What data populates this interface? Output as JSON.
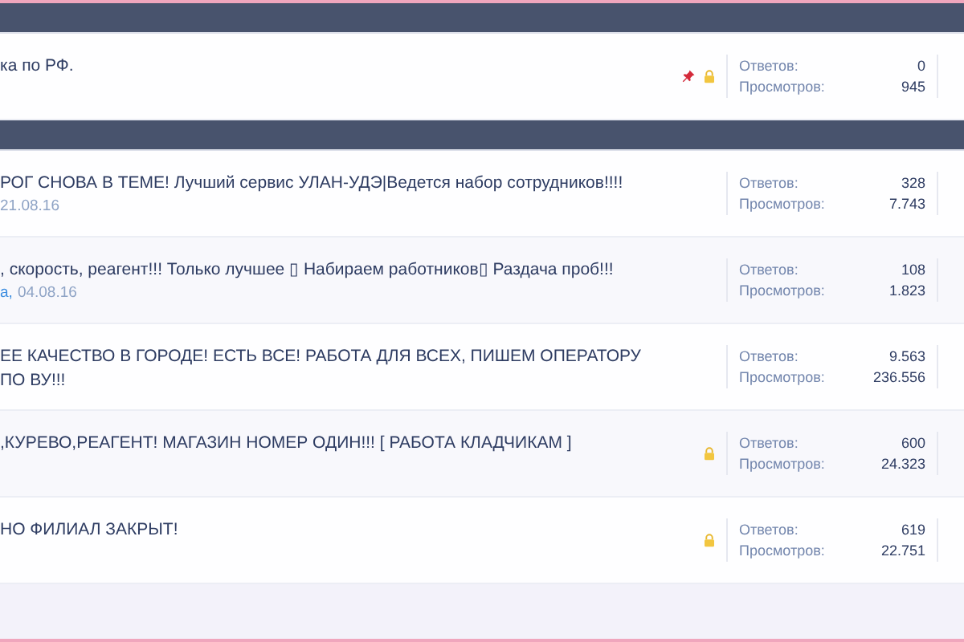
{
  "sections": [
    {
      "threads": [
        {
          "title": "ка по РФ.",
          "pinned": true,
          "locked": true,
          "replies_label": "Ответов:",
          "replies": "0",
          "views_label": "Просмотров:",
          "views": "945"
        }
      ]
    },
    {
      "threads": [
        {
          "title": "РОГ СНОВА В ТЕМЕ! Лучший сервис УЛАН-УДЭ|Ведется набор сотрудников!!!!",
          "date": "21.08.16",
          "pinned": false,
          "locked": false,
          "replies_label": "Ответов:",
          "replies": "328",
          "views_label": "Просмотров:",
          "views": "7.743"
        },
        {
          "title": ", скорость, реагент!!! Только лучшее ▯ Набираем работников▯ Раздача проб!!!",
          "author": "а,",
          "date": "04.08.16",
          "pinned": false,
          "locked": false,
          "replies_label": "Ответов:",
          "replies": "108",
          "views_label": "Просмотров:",
          "views": "1.823"
        },
        {
          "title": "ЕЕ КАЧЕСТВО В ГОРОДЕ! ЕСТЬ ВСЕ! РАБОТА ДЛЯ ВСЕХ, ПИШЕМ ОПЕРАТОРУ ПО ВУ!!!",
          "pinned": false,
          "locked": false,
          "replies_label": "Ответов:",
          "replies": "9.563",
          "views_label": "Просмотров:",
          "views": "236.556"
        },
        {
          "title": ",КУРЕВО,РЕАГЕНТ! МАГАЗИН НОМЕР ОДИН!!! [ РАБОТА КЛАДЧИКАМ ]",
          "pinned": false,
          "locked": true,
          "replies_label": "Ответов:",
          "replies": "600",
          "views_label": "Просмотров:",
          "views": "24.323"
        },
        {
          "title": "НО ФИЛИАЛ ЗАКРЫТ!",
          "pinned": false,
          "locked": true,
          "replies_label": "Ответов:",
          "replies": "619",
          "views_label": "Просмотров:",
          "views": "22.751"
        }
      ]
    }
  ]
}
